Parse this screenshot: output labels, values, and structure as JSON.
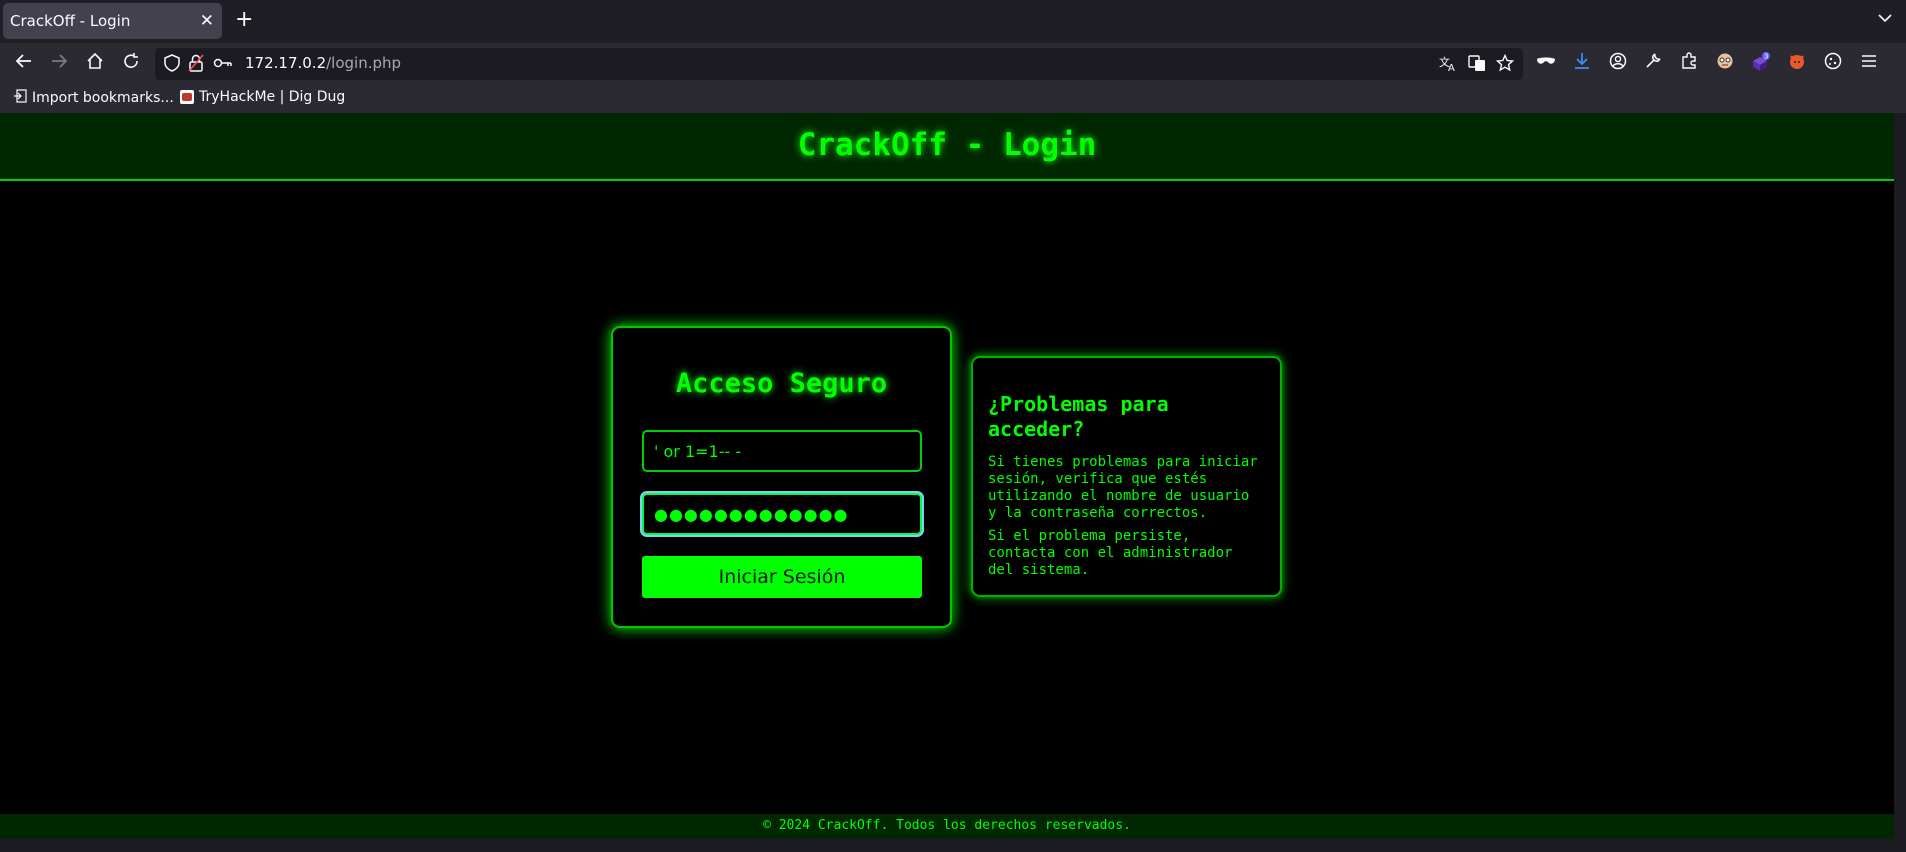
{
  "browser": {
    "tab_title": "CrackOff - Login",
    "tab_close": "✕",
    "new_tab": "+",
    "tab_list": "⌄",
    "url_host": "172.17.0.2",
    "url_path": "/login.php",
    "bookmarks": [
      {
        "label": "Import bookmarks..."
      },
      {
        "label": "TryHackMe | Dig Dug"
      }
    ]
  },
  "header": {
    "title": "CrackOff - Login"
  },
  "login": {
    "title": "Acceso Seguro",
    "username_value": "' or 1=1-- -",
    "password_value": "●●●●●●●●●●●●●",
    "submit_label": "Iniciar Sesión"
  },
  "help": {
    "title": "¿Problemas para acceder?",
    "paragraph1": "Si tienes problemas para iniciar sesión, verifica que estés utilizando el nombre de usuario y la contraseña correctos.",
    "paragraph2": "Si el problema persiste, contacta con el administrador del sistema."
  },
  "footer": {
    "text": "© 2024 CrackOff. Todos los derechos reservados."
  },
  "colors": {
    "accent": "#00ff00",
    "header_bg": "#002700",
    "page_bg": "#000000"
  }
}
